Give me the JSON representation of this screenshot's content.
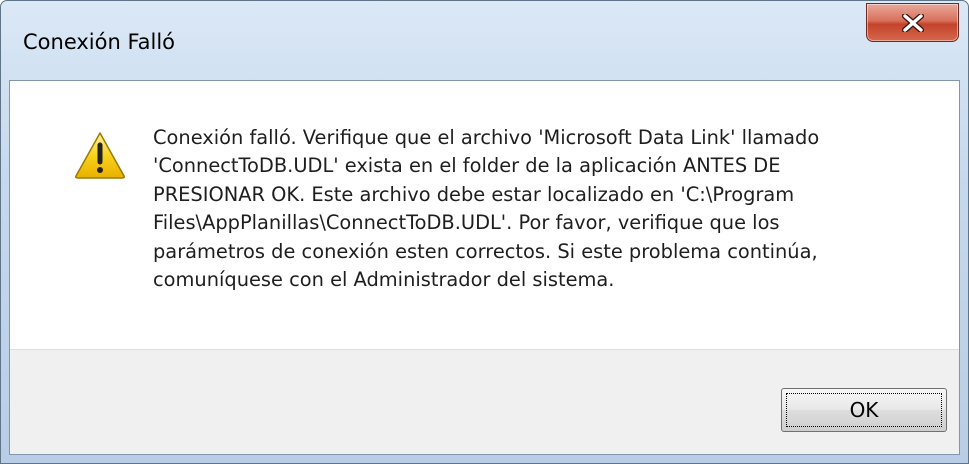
{
  "dialog": {
    "title": "Conexión Falló",
    "close_icon": "close-icon",
    "warning_icon": "warning-icon",
    "message_lines": [
      "Conexión falló. Verifique que el archivo 'Microsoft Data Link' llamado",
      "'ConnectToDB.UDL' exista en el folder de la aplicación ANTES DE",
      "PRESIONAR OK.  Este archivo debe estar localizado en 'C:\\Program",
      "Files\\AppPlanillas\\ConnectToDB.UDL'.  Por favor, verifique que los",
      "parámetros de conexión esten correctos.  Si este problema continúa,",
      "comuníquese con el Administrador del sistema."
    ],
    "ok_label": "OK"
  },
  "colors": {
    "title_bar": "#c5d8ee",
    "close_button": "#c4432a",
    "warning_yellow": "#f5c400",
    "footer_background": "#f0f0f0"
  }
}
